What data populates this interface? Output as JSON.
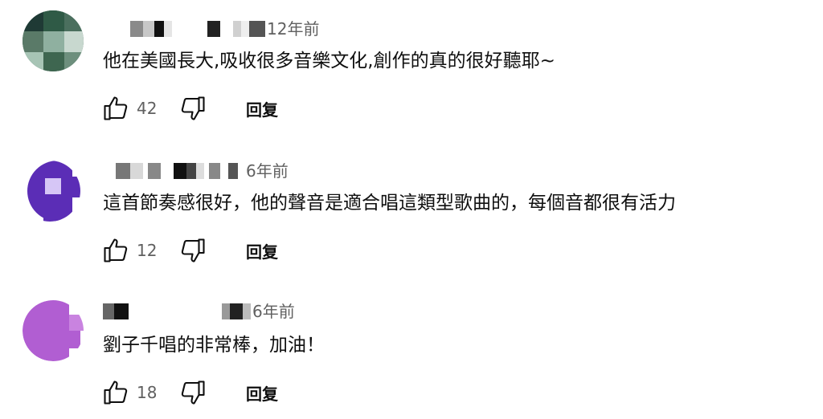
{
  "comments": [
    {
      "time": "12年前",
      "text": "他在美國長大,吸收很多音樂文化,創作的真的很好聽耶~",
      "likes": "42",
      "reply_label": "回复",
      "avatar_colors": [
        "#1f3a35",
        "#2f5a46",
        "#5a7a68",
        "#8fb0a0",
        "#3e6650",
        "#a7c4b5",
        "#c8d8cf"
      ]
    },
    {
      "time": "6年前",
      "text": "這首節奏感很好，他的聲音是適合唱這類型歌曲的，每個音都很有活力",
      "likes": "12",
      "reply_label": "回复",
      "avatar_colors": [
        "#5b2db6",
        "#d6c6f6"
      ]
    },
    {
      "time": "6年前",
      "text": "劉子千唱的非常棒，加油！",
      "likes": "18",
      "reply_label": "回复",
      "avatar_colors": [
        "#b15ed2",
        "#c983e0"
      ]
    }
  ]
}
